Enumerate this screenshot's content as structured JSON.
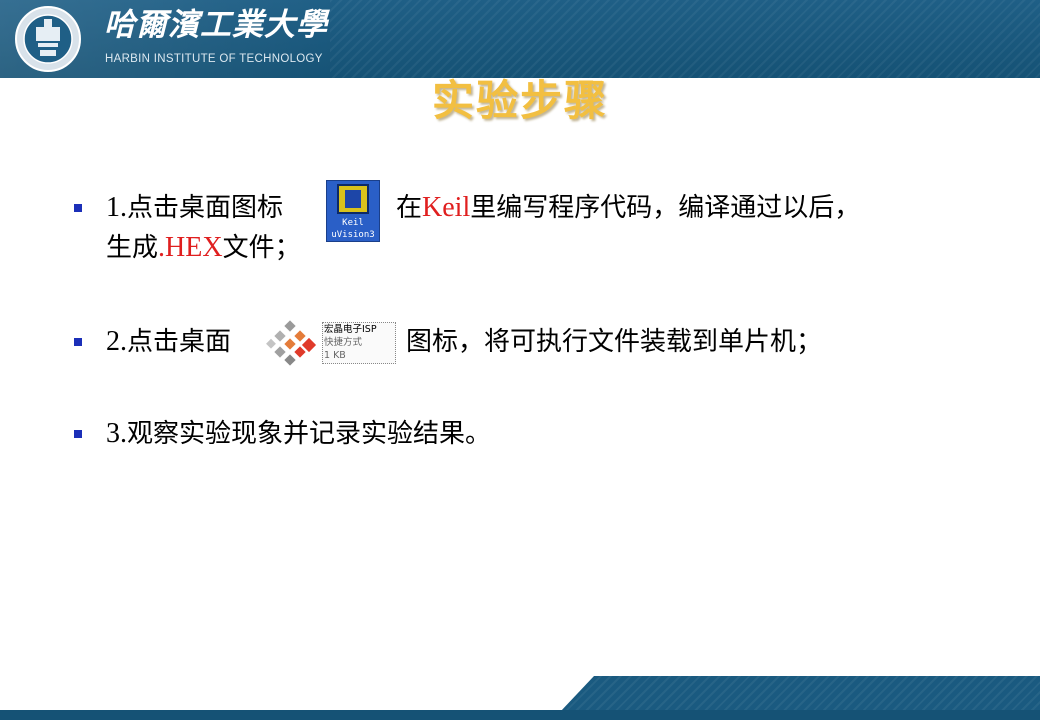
{
  "header": {
    "school_name_cn": "哈爾濱工業大學",
    "school_name_en": "HARBIN INSTITUTE OF TECHNOLOGY",
    "logo_icon": "hit-seal-icon",
    "colors": {
      "band": "#155275",
      "title": "#f2bf41",
      "bullet": "#1b2fb8",
      "highlight": "#e01f1f"
    }
  },
  "title": "实验步骤",
  "steps": [
    {
      "num": "1.",
      "text_a": "点击桌面图标",
      "text_b": "在",
      "keil": "Keil",
      "text_c": "里编写程序代码，编译通过以后，",
      "line2_a": "生成",
      "hex": ".HEX",
      "line2_b": "文件；",
      "icon": {
        "name": "keil-uvision3-icon",
        "line1": "Keil",
        "line2": "uVision3"
      }
    },
    {
      "num": "2.",
      "text_a": "点击桌面",
      "text_b": "图标，将可执行文件装载到单片机；",
      "icon": {
        "name": "stc-isp-shortcut-icon",
        "line1": "宏晶电子ISP",
        "line2": "快捷方式",
        "line3": "1 KB"
      }
    },
    {
      "num": "3.",
      "text_a": "观察实验现象并记录实验结果。"
    }
  ]
}
